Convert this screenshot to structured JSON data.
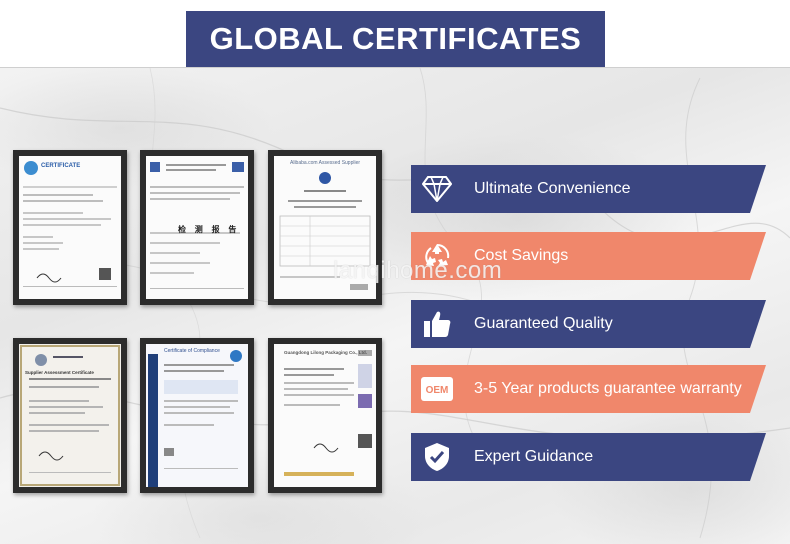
{
  "header": {
    "title": "GLOBAL CERTIFICATES"
  },
  "watermark": "lanqihome.com",
  "certificates": [
    {
      "name": "certificate",
      "heading": "CERTIFICATE"
    },
    {
      "name": "test-report",
      "heading": "检 测 报 告"
    },
    {
      "name": "assessed-supplier",
      "heading": "Alibaba.com Assessed Supplier"
    },
    {
      "name": "supplier-assessment",
      "heading": "Supplier Assessment Certificate"
    },
    {
      "name": "certificate-of-compliance",
      "heading": "Certificate of Compliance"
    },
    {
      "name": "packaging-certificate",
      "heading": "Guangdong Lilong Packaging Co., Ltd."
    }
  ],
  "features": [
    {
      "label": "Ultimate Convenience",
      "icon": "diamond-icon",
      "color": "#3b4681"
    },
    {
      "label": "Cost Savings",
      "icon": "recycle-icon",
      "color": "#f0876b"
    },
    {
      "label": "Guaranteed Quality",
      "icon": "thumbs-up-icon",
      "color": "#3b4681"
    },
    {
      "label": "3-5 Year products guarantee warranty",
      "icon": "oem-icon",
      "color": "#f0876b"
    },
    {
      "label": "Expert Guidance",
      "icon": "shield-check-icon",
      "color": "#3b4681"
    }
  ],
  "colors": {
    "navy": "#3b4681",
    "coral": "#f0876b"
  }
}
